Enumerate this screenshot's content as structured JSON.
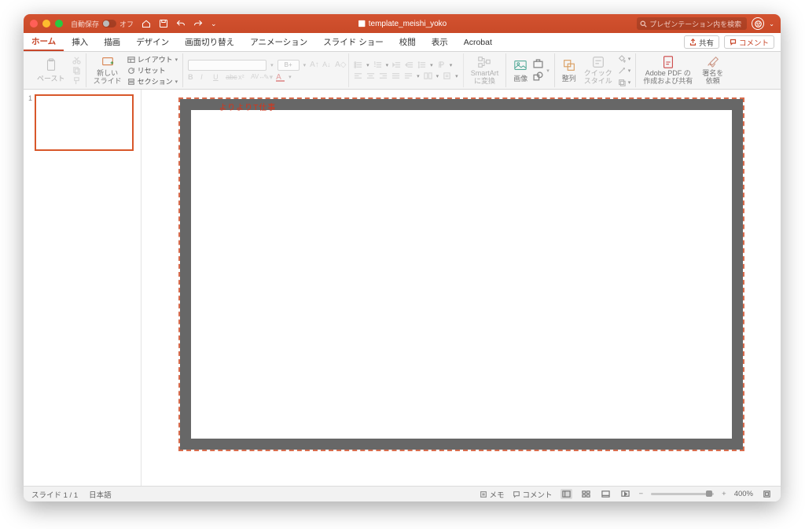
{
  "titlebar": {
    "autosave_label": "自動保存",
    "autosave_state": "オフ",
    "filename": "template_meishi_yoko",
    "search_placeholder": "プレゼンテーション内を検索"
  },
  "tabs": {
    "items": [
      "ホーム",
      "挿入",
      "描画",
      "デザイン",
      "画面切り替え",
      "アニメーション",
      "スライド ショー",
      "校閲",
      "表示",
      "Acrobat"
    ],
    "active_index": 0,
    "share": "共有",
    "comment": "コメント"
  },
  "ribbon": {
    "paste": "ペースト",
    "new_slide": "新しい\nスライド",
    "layout": "レイアウト",
    "reset": "リセット",
    "section": "セクション",
    "font_size_placeholder": "B+",
    "smartart": "SmartArt\nに変換",
    "picture": "画像",
    "arrange": "整列",
    "quickstyle": "クイック\nスタイル",
    "adobe": "Adobe PDF の\n作成および共有",
    "signature": "署名を\n依頼"
  },
  "thumbs": {
    "num": "1"
  },
  "slide": {
    "red_text": "よりよりT仕事"
  },
  "status": {
    "slide_counter": "スライド 1 / 1",
    "language": "日本語",
    "notes": "メモ",
    "comments": "コメント",
    "zoom": "400%"
  }
}
